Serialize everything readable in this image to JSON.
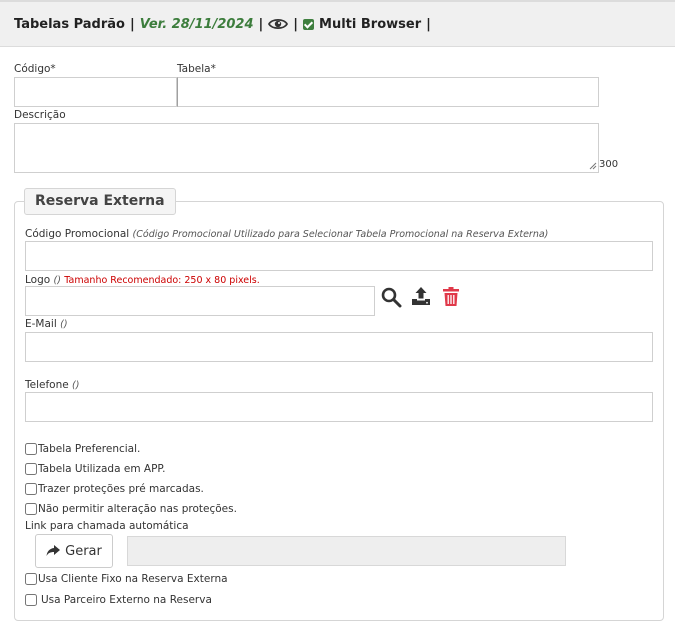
{
  "header": {
    "title": "Tabelas Padrão",
    "separator": "|",
    "version": "Ver. 28/11/2024",
    "multi_browser_label": "Multi Browser"
  },
  "form": {
    "codigo_label": "Código*",
    "codigo_value": "",
    "tabela_label": "Tabela*",
    "tabela_value": "",
    "descricao_label": "Descrição",
    "descricao_value": "",
    "descricao_counter": "300"
  },
  "reserva": {
    "legend": "Reserva Externa",
    "codigo_promocional_label": "Código Promocional",
    "codigo_promocional_hint": "(Código Promocional Utilizado para Selecionar Tabela Promocional na Reserva Externa)",
    "logo_label": "Logo",
    "logo_hint": "()",
    "logo_size_note": "Tamanho Recomendado: 250 x 80 pixels.",
    "email_label": "E-Mail",
    "email_hint": "()",
    "telefone_label": "Telefone",
    "telefone_hint": "()",
    "checkboxes": [
      {
        "label": "Tabela Preferencial.",
        "checked": false
      },
      {
        "label": "Tabela Utilizada em APP.",
        "checked": false
      },
      {
        "label": "Trazer proteções pré marcadas.",
        "checked": false
      },
      {
        "label": "Não permitir alteração nas proteções.",
        "checked": false
      }
    ],
    "link_label": "Link para chamada automática",
    "gerar_label": "Gerar",
    "link_value": "",
    "checkboxes_bottom": [
      {
        "label": "Usa Cliente Fixo na Reserva Externa",
        "checked": false
      },
      {
        "label": "Usa Parceiro Externo na Reserva",
        "checked": false
      }
    ]
  },
  "colors": {
    "version_green": "#3c7d3c",
    "size_note_red": "#cc0000",
    "delete_icon_red": "#e0394a",
    "icon_dark": "#333333"
  },
  "icons": [
    "eye-icon",
    "check-square-icon",
    "search-icon",
    "upload-icon",
    "trash-icon",
    "share-arrow-icon"
  ]
}
